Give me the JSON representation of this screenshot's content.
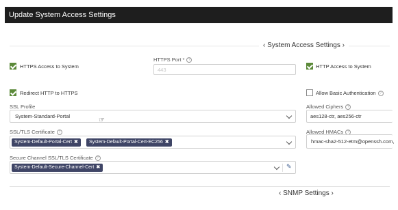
{
  "dialog": {
    "title": "Update System Access Settings"
  },
  "sections": {
    "system_access": "‹ System Access Settings ›",
    "snmp": "‹ SNMP Settings ›"
  },
  "https_access": {
    "label": "HTTPS Access to System",
    "checked": true
  },
  "https_port": {
    "label": "HTTPS Port *",
    "info": "?",
    "value": "443"
  },
  "http_access": {
    "label": "HTTP Access to System",
    "checked": true
  },
  "redirect": {
    "label": "Redirect HTTP to HTTPS",
    "checked": true
  },
  "basic_auth": {
    "label": "Allow Basic Authentication",
    "info": "?",
    "checked": false
  },
  "ssl_profile": {
    "label": "SSL Profile",
    "value": "System-Standard-Portal"
  },
  "allowed_ciphers": {
    "label": "Allowed Ciphers",
    "info": "?",
    "value": "aes128-ctr, aes256-ctr"
  },
  "ssl_cert": {
    "label": "SSL/TLS Certificate",
    "info": "?",
    "tags": [
      "System-Default-Portal-Cert",
      "System-Default-Portal-Cert-EC256"
    ],
    "remove_glyph": "✖"
  },
  "allowed_hmacs": {
    "label": "Allowed HMACs",
    "info": "?",
    "value": "hmac-sha2-512-etm@openssh.com,"
  },
  "secure_channel": {
    "label": "Secure Channel SSL/TLS Certificate",
    "info": "?",
    "tags": [
      "System-Default-Secure-Channel-Cert"
    ],
    "remove_glyph": "✖"
  },
  "icons": {
    "edit": "pencil-icon",
    "dropdown": "chevron-down-icon",
    "check": "check-icon"
  },
  "colors": {
    "accent": "#5c8a3a",
    "tag": "#3f4566",
    "titlebar": "#1e1e1e"
  }
}
